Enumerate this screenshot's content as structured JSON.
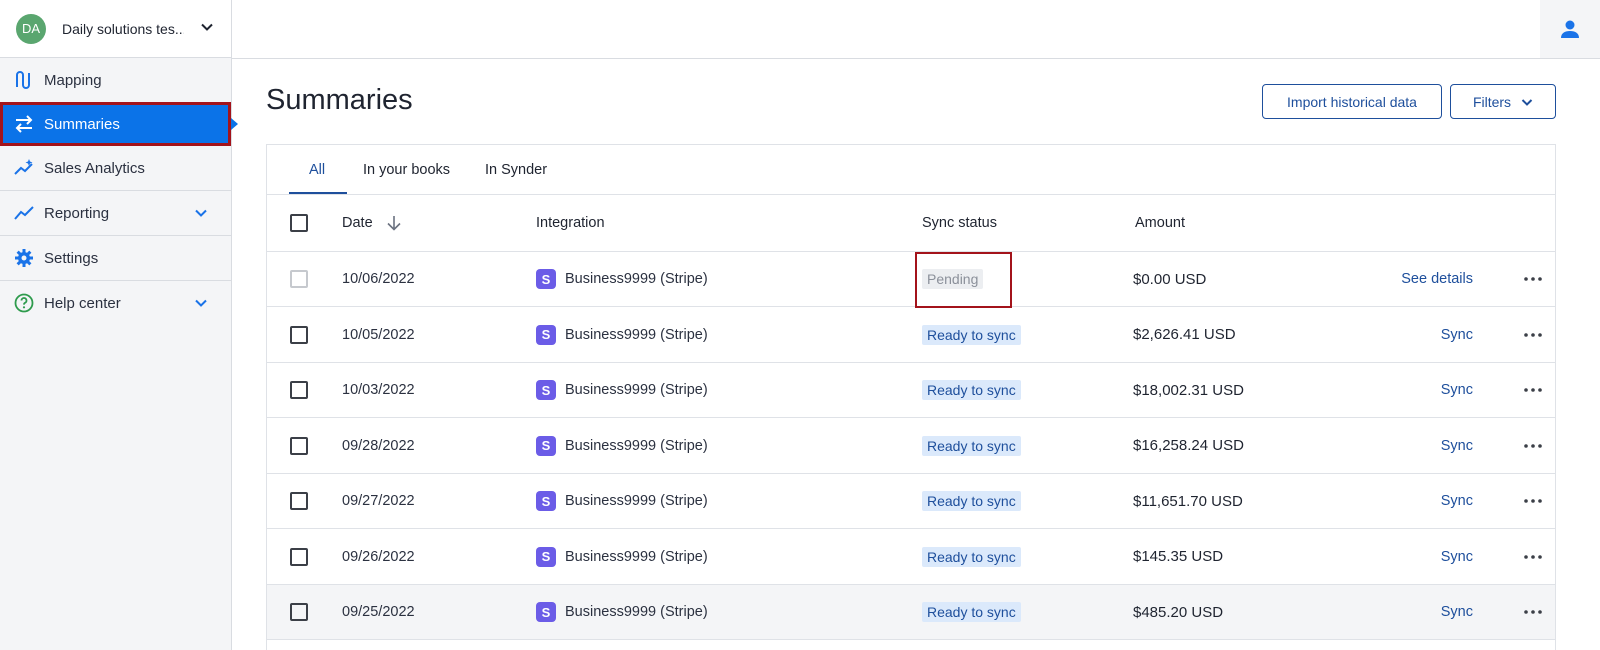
{
  "account": {
    "initials": "DA",
    "name": "Daily solutions tes..."
  },
  "sidebar": {
    "items": [
      {
        "label": "Mapping"
      },
      {
        "label": "Summaries"
      },
      {
        "label": "Sales Analytics"
      },
      {
        "label": "Reporting"
      },
      {
        "label": "Settings"
      },
      {
        "label": "Help center"
      }
    ]
  },
  "page": {
    "title": "Summaries"
  },
  "toolbar": {
    "import_label": "Import historical data",
    "filters_label": "Filters"
  },
  "tabs": [
    {
      "label": "All"
    },
    {
      "label": "In your books"
    },
    {
      "label": "In Synder"
    }
  ],
  "table": {
    "columns": {
      "date": "Date",
      "integration": "Integration",
      "sync_status": "Sync status",
      "amount": "Amount"
    },
    "rows": [
      {
        "date": "10/06/2022",
        "integration": "Business9999 (Stripe)",
        "status": "Pending",
        "amount": "$0.00 USD",
        "action": "See details"
      },
      {
        "date": "10/05/2022",
        "integration": "Business9999 (Stripe)",
        "status": "Ready to sync",
        "amount": "$2,626.41 USD",
        "action": "Sync"
      },
      {
        "date": "10/03/2022",
        "integration": "Business9999 (Stripe)",
        "status": "Ready to sync",
        "amount": "$18,002.31 USD",
        "action": "Sync"
      },
      {
        "date": "09/28/2022",
        "integration": "Business9999 (Stripe)",
        "status": "Ready to sync",
        "amount": "$16,258.24 USD",
        "action": "Sync"
      },
      {
        "date": "09/27/2022",
        "integration": "Business9999 (Stripe)",
        "status": "Ready to sync",
        "amount": "$11,651.70 USD",
        "action": "Sync"
      },
      {
        "date": "09/26/2022",
        "integration": "Business9999 (Stripe)",
        "status": "Ready to sync",
        "amount": "$145.35 USD",
        "action": "Sync"
      },
      {
        "date": "09/25/2022",
        "integration": "Business9999 (Stripe)",
        "status": "Ready to sync",
        "amount": "$485.20 USD",
        "action": "Sync"
      }
    ],
    "integration_logo_letter": "S"
  },
  "colors": {
    "accent": "#0b73e8",
    "link": "#1e4f9c",
    "highlight": "#a3131b",
    "stripe": "#6b5ce7"
  }
}
